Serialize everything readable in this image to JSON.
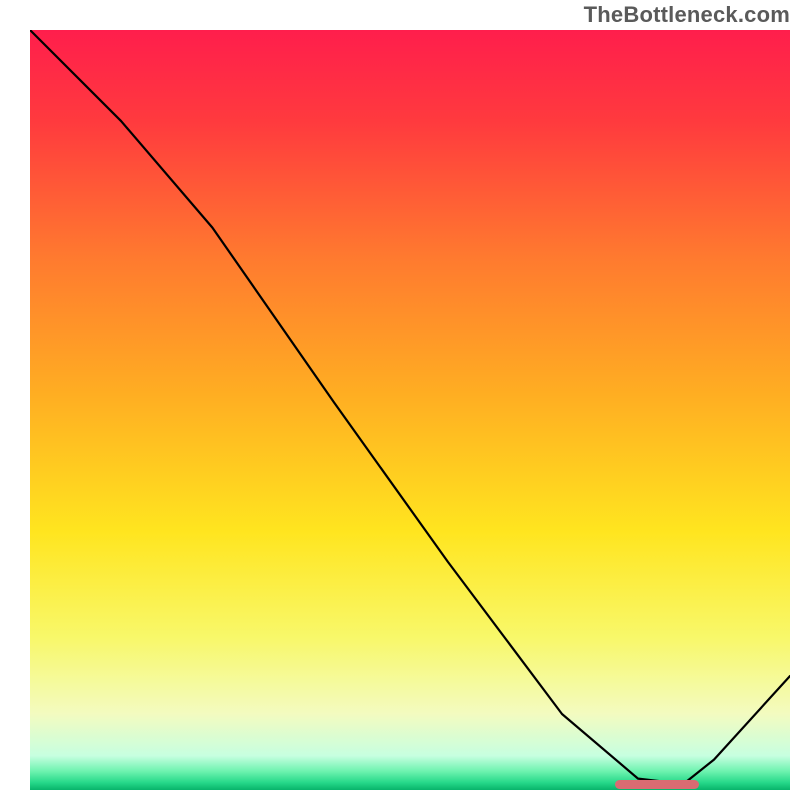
{
  "watermark": "TheBottleneck.com",
  "colors": {
    "gradient_stops": [
      {
        "offset": 0.0,
        "color": "#ff1e4c"
      },
      {
        "offset": 0.12,
        "color": "#ff3a3e"
      },
      {
        "offset": 0.3,
        "color": "#ff7a2f"
      },
      {
        "offset": 0.48,
        "color": "#ffae22"
      },
      {
        "offset": 0.66,
        "color": "#ffe51f"
      },
      {
        "offset": 0.8,
        "color": "#f8f86a"
      },
      {
        "offset": 0.9,
        "color": "#f3fbc0"
      },
      {
        "offset": 0.955,
        "color": "#c7ffe0"
      },
      {
        "offset": 0.975,
        "color": "#6ff3b0"
      },
      {
        "offset": 0.99,
        "color": "#27d98a"
      },
      {
        "offset": 1.0,
        "color": "#08b46b"
      }
    ],
    "line": "#000000",
    "marker": "#d96b72"
  },
  "chart_data": {
    "type": "line",
    "title": "",
    "xlabel": "",
    "ylabel": "",
    "watermark": "TheBottleneck.com",
    "xlim": [
      0,
      100
    ],
    "ylim": [
      0,
      100
    ],
    "x": [
      0,
      12,
      24,
      40,
      55,
      70,
      80,
      86,
      90,
      100
    ],
    "values": [
      100,
      88,
      74,
      51,
      30,
      10,
      1.5,
      0.8,
      4,
      15
    ],
    "marker_segment": {
      "x_start": 77,
      "x_end": 88,
      "y": 0.8
    }
  }
}
